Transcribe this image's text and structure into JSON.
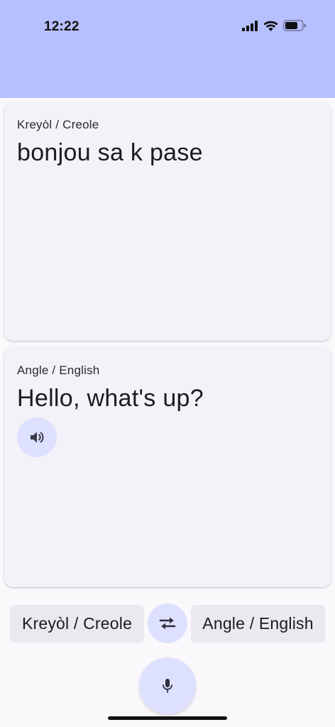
{
  "status_bar": {
    "time": "12:22"
  },
  "source": {
    "language_label": "Kreyòl / Creole",
    "text": "bonjou sa k pase"
  },
  "target": {
    "language_label": "Angle / English",
    "text": "Hello, what's up?"
  },
  "language_bar": {
    "source_language": "Kreyòl / Creole",
    "target_language": "Angle / English"
  },
  "icons": {
    "speaker": "speaker-icon",
    "swap": "swap-arrows-icon",
    "mic": "microphone-icon"
  },
  "colors": {
    "app_bar": "#b7c0ff",
    "card_background": "#f4f1f8",
    "tonal_button": "#dde1ff",
    "chip_background": "#ebe8ef",
    "page_background": "#fbf8fc"
  }
}
